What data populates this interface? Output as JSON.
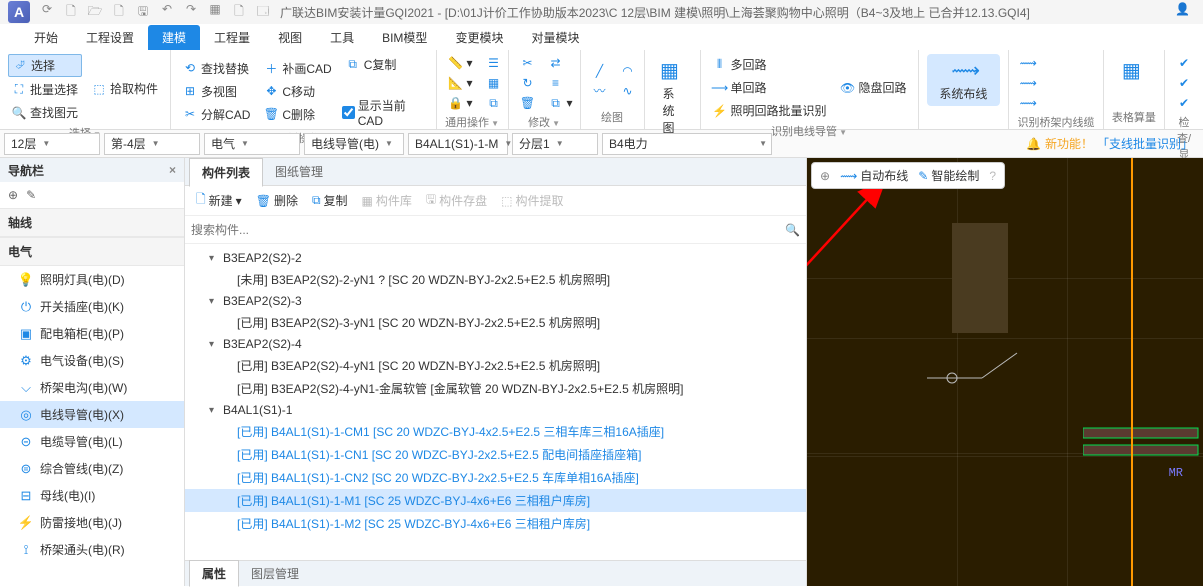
{
  "app": {
    "logo_letter": "A",
    "title": "广联达BIM安装计量GQI2021 - [D:\\01J计价工作协助版本2023\\C 12层\\BIM 建模\\照明\\上海荟聚购物中心照明（B4~3及地上  已合并12.13.GQI4]",
    "qat_icons": [
      "⟳",
      "🗋",
      "🗁",
      "🗋",
      "🖫",
      "↶",
      "↷",
      "▦",
      "🗋",
      "🗔"
    ]
  },
  "menu_tabs": [
    "开始",
    "工程设置",
    "建模",
    "工程量",
    "视图",
    "工具",
    "BIM模型",
    "变更模块",
    "对量模块"
  ],
  "menu_active_index": 2,
  "ribbon": {
    "select_group": {
      "select": "选择",
      "batch_select": "批量选择",
      "find_element": "查找图元",
      "pick_component": "拾取构件",
      "label": "选择"
    },
    "drawing_group": {
      "find_replace": "查找替换",
      "multi_view": "多视图",
      "decompose_cad": "分解CAD",
      "supplement_cad": "补画CAD",
      "c_move": "C移动",
      "c_delete": "C删除",
      "c_copy": "C复制",
      "show_current_cad": "显示当前CAD",
      "label": "图纸操作"
    },
    "common_group": {
      "label": "通用操作"
    },
    "modify_group": {
      "label": "修改"
    },
    "draw_group": {
      "label": "绘图"
    },
    "system_group": {
      "system_diagram": "系统图",
      "label": ""
    },
    "circuit_group": {
      "multi_circuit": "多回路",
      "single_circuit": "单回路",
      "lighting_batch": "照明回路批量识别",
      "hide_circuit": "隐盘回路",
      "label": "识别电线导管"
    },
    "system_wiring": {
      "label": "系统布线"
    },
    "bridge_group": {
      "label": "识别桥架内线缆"
    },
    "table_group": {
      "label": "表格算量"
    },
    "check_group": {
      "label": "检查/显"
    }
  },
  "filter_bar": {
    "floor": "12层",
    "sub_floor": "第-4层",
    "discipline": "电气",
    "conduit": "电线导管(电)",
    "component": "B4AL1(S1)-1-M",
    "layer": "分层1",
    "panel": "B4电力",
    "new_feature_text": "新功能！",
    "new_feature_link": "「支线批量识别」"
  },
  "nav": {
    "header": "导航栏",
    "section_axis": "轴线",
    "section_elec": "电气",
    "items": [
      {
        "icon": "💡",
        "label": "照明灯具(电)(D)"
      },
      {
        "icon": "⏻",
        "label": "开关插座(电)(K)"
      },
      {
        "icon": "▣",
        "label": "配电箱柜(电)(P)"
      },
      {
        "icon": "⚙",
        "label": "电气设备(电)(S)"
      },
      {
        "icon": "⌵",
        "label": "桥架电沟(电)(W)"
      },
      {
        "icon": "◎",
        "label": "电线导管(电)(X)"
      },
      {
        "icon": "⊝",
        "label": "电缆导管(电)(L)"
      },
      {
        "icon": "⊜",
        "label": "综合管线(电)(Z)"
      },
      {
        "icon": "⊟",
        "label": "母线(电)(I)"
      },
      {
        "icon": "⚡",
        "label": "防雷接地(电)(J)"
      },
      {
        "icon": "⟟",
        "label": "桥架通头(电)(R)"
      }
    ],
    "selected_index": 5
  },
  "center": {
    "tabs": [
      "构件列表",
      "图纸管理"
    ],
    "active_tab": 0,
    "toolbar": {
      "new": "新建",
      "delete": "删除",
      "copy": "复制",
      "lib": "构件库",
      "save": "构件存盘",
      "extract": "构件提取"
    },
    "search_placeholder": "搜索构件...",
    "tree": [
      {
        "level": 1,
        "type": "group",
        "label": "B3EAP2(S2)-2"
      },
      {
        "level": 2,
        "type": "leaf",
        "color": "black",
        "label": "[未用] B3EAP2(S2)-2-yN1 ? [SC 20 WDZN-BYJ-2x2.5+E2.5 机房照明]"
      },
      {
        "level": 1,
        "type": "group",
        "label": "B3EAP2(S2)-3"
      },
      {
        "level": 2,
        "type": "leaf",
        "color": "black",
        "label": "[已用] B3EAP2(S2)-3-yN1 [SC 20 WDZN-BYJ-2x2.5+E2.5 机房照明]"
      },
      {
        "level": 1,
        "type": "group",
        "label": "B3EAP2(S2)-4"
      },
      {
        "level": 2,
        "type": "leaf",
        "color": "black",
        "label": "[已用] B3EAP2(S2)-4-yN1 [SC 20 WDZN-BYJ-2x2.5+E2.5 机房照明]"
      },
      {
        "level": 2,
        "type": "leaf",
        "color": "black",
        "label": "[已用] B3EAP2(S2)-4-yN1-金属软管 [金属软管 20 WDZN-BYJ-2x2.5+E2.5 机房照明]"
      },
      {
        "level": 1,
        "type": "group",
        "label": "B4AL1(S1)-1"
      },
      {
        "level": 2,
        "type": "leaf",
        "color": "blue",
        "label": "[已用] B4AL1(S1)-1-CM1 [SC 20 WDZC-BYJ-4x2.5+E2.5 三相车库三相16A插座]"
      },
      {
        "level": 2,
        "type": "leaf",
        "color": "blue",
        "label": "[已用] B4AL1(S1)-1-CN1 [SC 20 WDZC-BYJ-2x2.5+E2.5 配电间插座插座箱]"
      },
      {
        "level": 2,
        "type": "leaf",
        "color": "blue",
        "label": "[已用] B4AL1(S1)-1-CN2 [SC 20 WDZC-BYJ-2x2.5+E2.5 车库单相16A插座]"
      },
      {
        "level": 2,
        "type": "leaf",
        "color": "blue",
        "selected": true,
        "label": "[已用] B4AL1(S1)-1-M1 [SC 25 WDZC-BYJ-4x6+E6 三相租户库房]"
      },
      {
        "level": 2,
        "type": "leaf",
        "color": "blue",
        "label": "[已用] B4AL1(S1)-1-M2 [SC 25 WDZC-BYJ-4x6+E6 三相租户库房]"
      }
    ],
    "bottom_tabs": [
      "属性",
      "图层管理"
    ],
    "bottom_active": 0
  },
  "canvas": {
    "float": {
      "auto_layout": "自动布线",
      "smart_draw": "智能绘制"
    },
    "label_mr": "MR"
  }
}
